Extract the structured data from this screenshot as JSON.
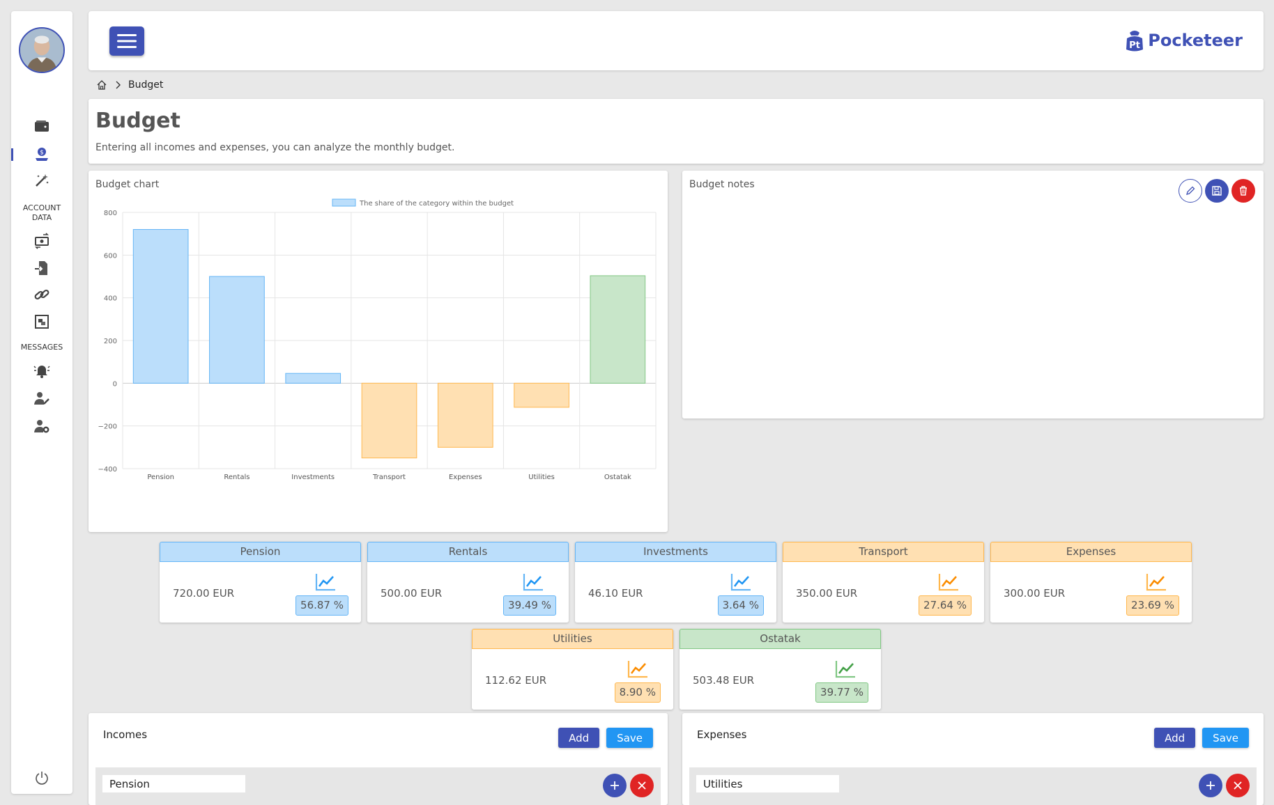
{
  "app": {
    "brand": "Pocketeer",
    "brand_badge": "Pt"
  },
  "sidebar": {
    "sections": {
      "account_data": "ACCOUNT\nDATA",
      "messages": "MESSAGES"
    },
    "icons": [
      "wallet-icon",
      "budget-icon",
      "magic-wand-icon",
      "transfer-icon",
      "import-icon",
      "link-icon",
      "image-gallery-icon",
      "alarm-bell-icon",
      "user-edit-icon",
      "user-settings-icon",
      "power-icon"
    ]
  },
  "breadcrumb": {
    "current": "Budget"
  },
  "header": {
    "title": "Budget",
    "description": "Entering all incomes and expenses, you can analyze the monthly budget."
  },
  "chart_card": {
    "title": "Budget chart"
  },
  "notes_card": {
    "title": "Budget notes"
  },
  "colors": {
    "blue_fill": "#bbdefb",
    "blue_border": "#64b5f6",
    "orange_fill": "#ffe0b2",
    "orange_border": "#ffb74d",
    "green_fill": "#c8e6c9",
    "green_border": "#81c784",
    "indigo": "#3f51b5",
    "red": "#e02424"
  },
  "chart_data": {
    "type": "bar",
    "categories": [
      "Pension",
      "Rentals",
      "Investments",
      "Transport",
      "Expenses",
      "Utilities",
      "Ostatak"
    ],
    "series": [
      {
        "name": "The share of the category within the budget",
        "values": [
          720,
          500,
          46.1,
          -350,
          -300,
          -112.62,
          503.48
        ]
      }
    ],
    "bar_colors": [
      "blue",
      "blue",
      "blue",
      "orange",
      "orange",
      "orange",
      "green"
    ],
    "yticks": [
      800,
      600,
      400,
      200,
      0,
      -200,
      -400
    ],
    "ytick_labels": [
      "800",
      "600",
      "400",
      "200",
      "0",
      "−200",
      "−400"
    ],
    "ylim": [
      -400,
      800
    ],
    "grid": true,
    "legend": "top-center"
  },
  "tiles": [
    {
      "name": "Pension",
      "value": "720.00 EUR",
      "percent": "56.87 %",
      "color": "blue",
      "percent_value": 56.87
    },
    {
      "name": "Rentals",
      "value": "500.00 EUR",
      "percent": "39.49 %",
      "color": "blue",
      "percent_value": 39.49
    },
    {
      "name": "Investments",
      "value": "46.10 EUR",
      "percent": "3.64 %",
      "color": "blue",
      "percent_value": 3.64
    },
    {
      "name": "Transport",
      "value": "350.00 EUR",
      "percent": "27.64 %",
      "color": "orange",
      "percent_value": 27.64
    },
    {
      "name": "Expenses",
      "value": "300.00 EUR",
      "percent": "23.69 %",
      "color": "orange",
      "percent_value": 23.69
    },
    {
      "name": "Utilities",
      "value": "112.62 EUR",
      "percent": "8.90 %",
      "color": "orange",
      "percent_value": 8.9
    },
    {
      "name": "Ostatak",
      "value": "503.48 EUR",
      "percent": "39.77 %",
      "color": "green",
      "percent_value": 39.77
    }
  ],
  "incomes": {
    "title": "Incomes",
    "add_label": "Add",
    "save_label": "Save",
    "rows": [
      {
        "value": "Pension"
      }
    ]
  },
  "expenses": {
    "title": "Expenses",
    "add_label": "Add",
    "save_label": "Save",
    "rows": [
      {
        "value": "Utilities"
      }
    ]
  }
}
